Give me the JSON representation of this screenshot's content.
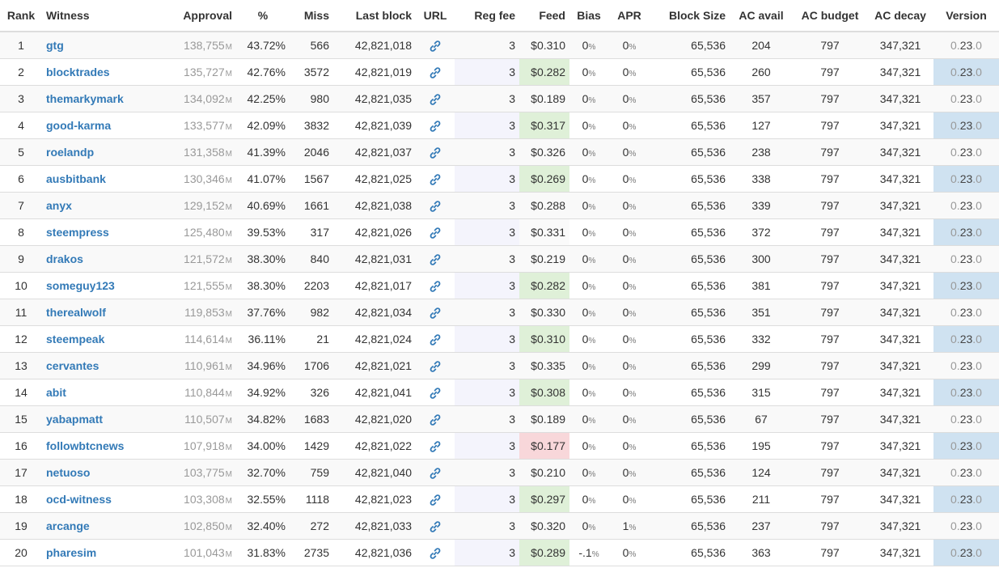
{
  "columns": {
    "rank": "Rank",
    "witness": "Witness",
    "approval": "Approval",
    "percent": "%",
    "miss": "Miss",
    "last_block": "Last block",
    "url": "URL",
    "reg_fee": "Reg fee",
    "feed": "Feed",
    "bias": "Bias",
    "apr": "APR",
    "block_size": "Block Size",
    "ac_avail": "AC avail",
    "ac_budget": "AC budget",
    "ac_decay": "AC decay",
    "version": "Version"
  },
  "approval_unit": "M",
  "percent_unit": "%",
  "icons": {
    "url": "link-icon"
  },
  "colors": {
    "link": "#337ab7",
    "feed_good": "#dff0d8",
    "feed_bad": "#f8d7da",
    "version_bg": "#cfe2f1",
    "reg_fee_bg": "#f4f4fc"
  },
  "rows": [
    {
      "rank": "1",
      "witness": "gtg",
      "approval": "138,755",
      "pct": "43.72%",
      "miss": "566",
      "last_block": "42,821,018",
      "reg_fee": "3",
      "feed": "$0.310",
      "feed_status": "good",
      "bias": "0",
      "apr": "0",
      "block_size": "65,536",
      "ac_avail": "204",
      "ac_budget": "797",
      "ac_decay": "347,321",
      "ver_a": "0.",
      "ver_b": "23",
      "ver_c": ".0"
    },
    {
      "rank": "2",
      "witness": "blocktrades",
      "approval": "135,727",
      "pct": "42.76%",
      "miss": "3572",
      "last_block": "42,821,019",
      "reg_fee": "3",
      "feed": "$0.282",
      "feed_status": "good",
      "bias": "0",
      "apr": "0",
      "block_size": "65,536",
      "ac_avail": "260",
      "ac_budget": "797",
      "ac_decay": "347,321",
      "ver_a": "0.",
      "ver_b": "23",
      "ver_c": ".0"
    },
    {
      "rank": "3",
      "witness": "themarkymark",
      "approval": "134,092",
      "pct": "42.25%",
      "miss": "980",
      "last_block": "42,821,035",
      "reg_fee": "3",
      "feed": "$0.189",
      "feed_status": "bad",
      "bias": "0",
      "apr": "0",
      "block_size": "65,536",
      "ac_avail": "357",
      "ac_budget": "797",
      "ac_decay": "347,321",
      "ver_a": "0.",
      "ver_b": "23",
      "ver_c": ".0"
    },
    {
      "rank": "4",
      "witness": "good-karma",
      "approval": "133,577",
      "pct": "42.09%",
      "miss": "3832",
      "last_block": "42,821,039",
      "reg_fee": "3",
      "feed": "$0.317",
      "feed_status": "good",
      "bias": "0",
      "apr": "0",
      "block_size": "65,536",
      "ac_avail": "127",
      "ac_budget": "797",
      "ac_decay": "347,321",
      "ver_a": "0.",
      "ver_b": "23",
      "ver_c": ".0"
    },
    {
      "rank": "5",
      "witness": "roelandp",
      "approval": "131,358",
      "pct": "41.39%",
      "miss": "2046",
      "last_block": "42,821,037",
      "reg_fee": "3",
      "feed": "$0.326",
      "feed_status": "good",
      "bias": "0",
      "apr": "0",
      "block_size": "65,536",
      "ac_avail": "238",
      "ac_budget": "797",
      "ac_decay": "347,321",
      "ver_a": "0.",
      "ver_b": "23",
      "ver_c": ".0"
    },
    {
      "rank": "6",
      "witness": "ausbitbank",
      "approval": "130,346",
      "pct": "41.07%",
      "miss": "1567",
      "last_block": "42,821,025",
      "reg_fee": "3",
      "feed": "$0.269",
      "feed_status": "good",
      "bias": "0",
      "apr": "0",
      "block_size": "65,536",
      "ac_avail": "338",
      "ac_budget": "797",
      "ac_decay": "347,321",
      "ver_a": "0.",
      "ver_b": "23",
      "ver_c": ".0"
    },
    {
      "rank": "7",
      "witness": "anyx",
      "approval": "129,152",
      "pct": "40.69%",
      "miss": "1661",
      "last_block": "42,821,038",
      "reg_fee": "3",
      "feed": "$0.288",
      "feed_status": "good",
      "bias": "0",
      "apr": "0",
      "block_size": "65,536",
      "ac_avail": "339",
      "ac_budget": "797",
      "ac_decay": "347,321",
      "ver_a": "0.",
      "ver_b": "23",
      "ver_c": ".0"
    },
    {
      "rank": "8",
      "witness": "steempress",
      "approval": "125,480",
      "pct": "39.53%",
      "miss": "317",
      "last_block": "42,821,026",
      "reg_fee": "3",
      "feed": "$0.331",
      "feed_status": "neutral",
      "bias": "0",
      "apr": "0",
      "block_size": "65,536",
      "ac_avail": "372",
      "ac_budget": "797",
      "ac_decay": "347,321",
      "ver_a": "0.",
      "ver_b": "23",
      "ver_c": ".0"
    },
    {
      "rank": "9",
      "witness": "drakos",
      "approval": "121,572",
      "pct": "38.30%",
      "miss": "840",
      "last_block": "42,821,031",
      "reg_fee": "3",
      "feed": "$0.219",
      "feed_status": "bad",
      "bias": "0",
      "apr": "0",
      "block_size": "65,536",
      "ac_avail": "300",
      "ac_budget": "797",
      "ac_decay": "347,321",
      "ver_a": "0.",
      "ver_b": "23",
      "ver_c": ".0"
    },
    {
      "rank": "10",
      "witness": "someguy123",
      "approval": "121,555",
      "pct": "38.30%",
      "miss": "2203",
      "last_block": "42,821,017",
      "reg_fee": "3",
      "feed": "$0.282",
      "feed_status": "good",
      "bias": "0",
      "apr": "0",
      "block_size": "65,536",
      "ac_avail": "381",
      "ac_budget": "797",
      "ac_decay": "347,321",
      "ver_a": "0.",
      "ver_b": "23",
      "ver_c": ".0"
    },
    {
      "rank": "11",
      "witness": "therealwolf",
      "approval": "119,853",
      "pct": "37.76%",
      "miss": "982",
      "last_block": "42,821,034",
      "reg_fee": "3",
      "feed": "$0.330",
      "feed_status": "neutral",
      "bias": "0",
      "apr": "0",
      "block_size": "65,536",
      "ac_avail": "351",
      "ac_budget": "797",
      "ac_decay": "347,321",
      "ver_a": "0.",
      "ver_b": "23",
      "ver_c": ".0"
    },
    {
      "rank": "12",
      "witness": "steempeak",
      "approval": "114,614",
      "pct": "36.11%",
      "miss": "21",
      "last_block": "42,821,024",
      "reg_fee": "3",
      "feed": "$0.310",
      "feed_status": "good",
      "bias": "0",
      "apr": "0",
      "block_size": "65,536",
      "ac_avail": "332",
      "ac_budget": "797",
      "ac_decay": "347,321",
      "ver_a": "0.",
      "ver_b": "23",
      "ver_c": ".0"
    },
    {
      "rank": "13",
      "witness": "cervantes",
      "approval": "110,961",
      "pct": "34.96%",
      "miss": "1706",
      "last_block": "42,821,021",
      "reg_fee": "3",
      "feed": "$0.335",
      "feed_status": "neutral",
      "bias": "0",
      "apr": "0",
      "block_size": "65,536",
      "ac_avail": "299",
      "ac_budget": "797",
      "ac_decay": "347,321",
      "ver_a": "0.",
      "ver_b": "23",
      "ver_c": ".0"
    },
    {
      "rank": "14",
      "witness": "abit",
      "approval": "110,844",
      "pct": "34.92%",
      "miss": "326",
      "last_block": "42,821,041",
      "reg_fee": "3",
      "feed": "$0.308",
      "feed_status": "good",
      "bias": "0",
      "apr": "0",
      "block_size": "65,536",
      "ac_avail": "315",
      "ac_budget": "797",
      "ac_decay": "347,321",
      "ver_a": "0.",
      "ver_b": "23",
      "ver_c": ".0"
    },
    {
      "rank": "15",
      "witness": "yabapmatt",
      "approval": "110,507",
      "pct": "34.82%",
      "miss": "1683",
      "last_block": "42,821,020",
      "reg_fee": "3",
      "feed": "$0.189",
      "feed_status": "bad",
      "bias": "0",
      "apr": "0",
      "block_size": "65,536",
      "ac_avail": "67",
      "ac_budget": "797",
      "ac_decay": "347,321",
      "ver_a": "0.",
      "ver_b": "23",
      "ver_c": ".0"
    },
    {
      "rank": "16",
      "witness": "followbtcnews",
      "approval": "107,918",
      "pct": "34.00%",
      "miss": "1429",
      "last_block": "42,821,022",
      "reg_fee": "3",
      "feed": "$0.177",
      "feed_status": "bad",
      "bias": "0",
      "apr": "0",
      "block_size": "65,536",
      "ac_avail": "195",
      "ac_budget": "797",
      "ac_decay": "347,321",
      "ver_a": "0.",
      "ver_b": "23",
      "ver_c": ".0"
    },
    {
      "rank": "17",
      "witness": "netuoso",
      "approval": "103,775",
      "pct": "32.70%",
      "miss": "759",
      "last_block": "42,821,040",
      "reg_fee": "3",
      "feed": "$0.210",
      "feed_status": "bad",
      "bias": "0",
      "apr": "0",
      "block_size": "65,536",
      "ac_avail": "124",
      "ac_budget": "797",
      "ac_decay": "347,321",
      "ver_a": "0.",
      "ver_b": "23",
      "ver_c": ".0"
    },
    {
      "rank": "18",
      "witness": "ocd-witness",
      "approval": "103,308",
      "pct": "32.55%",
      "miss": "1118",
      "last_block": "42,821,023",
      "reg_fee": "3",
      "feed": "$0.297",
      "feed_status": "good",
      "bias": "0",
      "apr": "0",
      "block_size": "65,536",
      "ac_avail": "211",
      "ac_budget": "797",
      "ac_decay": "347,321",
      "ver_a": "0.",
      "ver_b": "23",
      "ver_c": ".0"
    },
    {
      "rank": "19",
      "witness": "arcange",
      "approval": "102,850",
      "pct": "32.40%",
      "miss": "272",
      "last_block": "42,821,033",
      "reg_fee": "3",
      "feed": "$0.320",
      "feed_status": "neutral",
      "bias": "0",
      "apr": "1",
      "block_size": "65,536",
      "ac_avail": "237",
      "ac_budget": "797",
      "ac_decay": "347,321",
      "ver_a": "0.",
      "ver_b": "23",
      "ver_c": ".0"
    },
    {
      "rank": "20",
      "witness": "pharesim",
      "approval": "101,043",
      "pct": "31.83%",
      "miss": "2735",
      "last_block": "42,821,036",
      "reg_fee": "3",
      "feed": "$0.289",
      "feed_status": "good",
      "bias": "-.1",
      "apr": "0",
      "block_size": "65,536",
      "ac_avail": "363",
      "ac_budget": "797",
      "ac_decay": "347,321",
      "ver_a": "0.",
      "ver_b": "23",
      "ver_c": ".0"
    }
  ]
}
